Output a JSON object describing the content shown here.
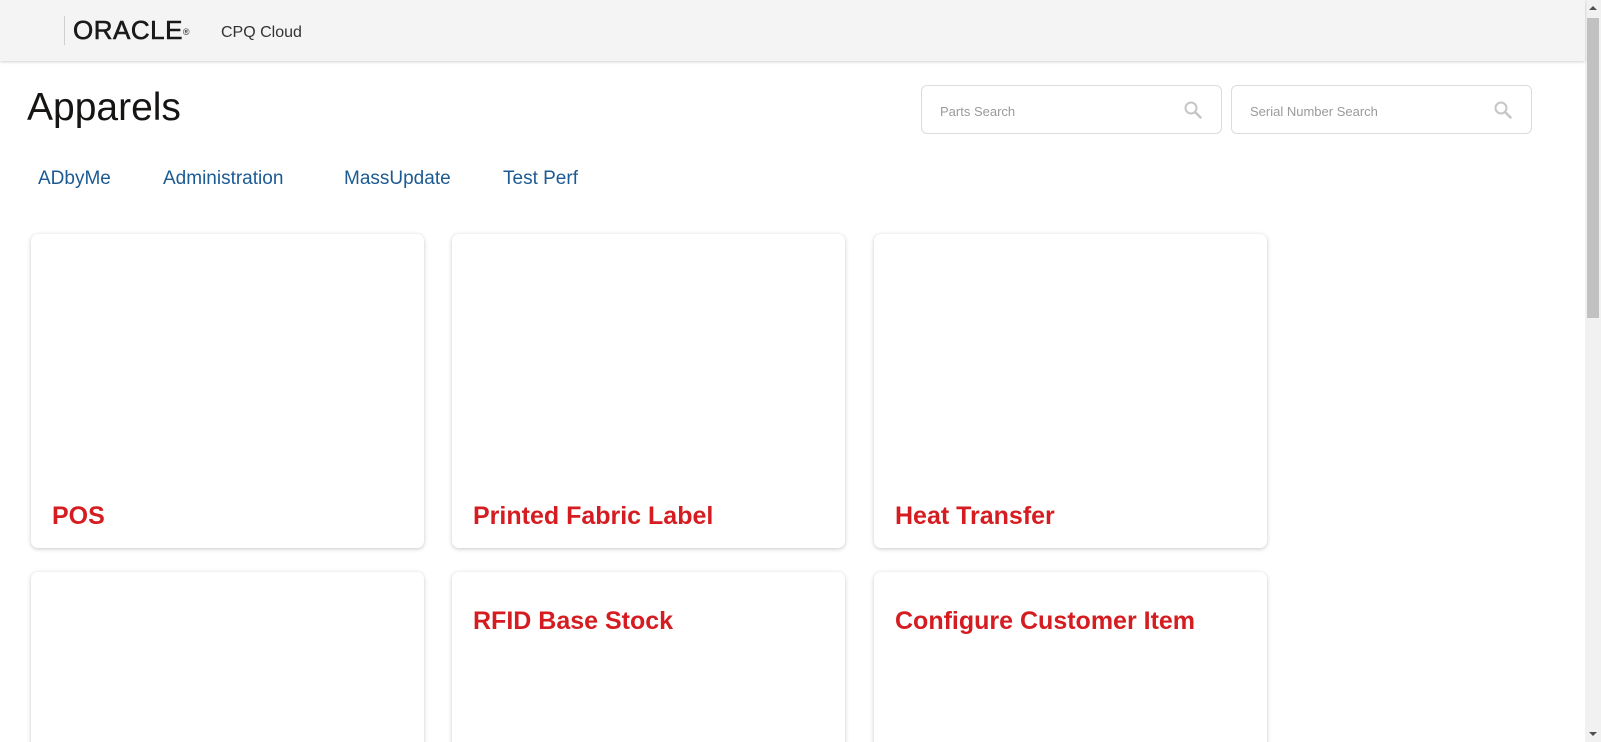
{
  "header": {
    "logo_text": "ORACLE",
    "logo_mark": "®",
    "product_name": "CPQ Cloud"
  },
  "page": {
    "title": "Apparels"
  },
  "search": {
    "parts_placeholder": "Parts Search",
    "serial_placeholder": "Serial Number Search",
    "icon": "search-icon"
  },
  "nav": {
    "links": [
      {
        "label": "ADbyMe"
      },
      {
        "label": "Administration"
      },
      {
        "label": "MassUpdate"
      },
      {
        "label": "Test Perf"
      }
    ]
  },
  "cards": [
    {
      "title": "POS"
    },
    {
      "title": "Printed Fabric Label"
    },
    {
      "title": "Heat Transfer"
    },
    {
      "title": ""
    },
    {
      "title": "RFID Base Stock"
    },
    {
      "title": "Configure Customer Item"
    }
  ],
  "colors": {
    "accent_red": "#d51d21",
    "link_blue": "#1c5a94",
    "header_bg": "#f4f4f4"
  }
}
